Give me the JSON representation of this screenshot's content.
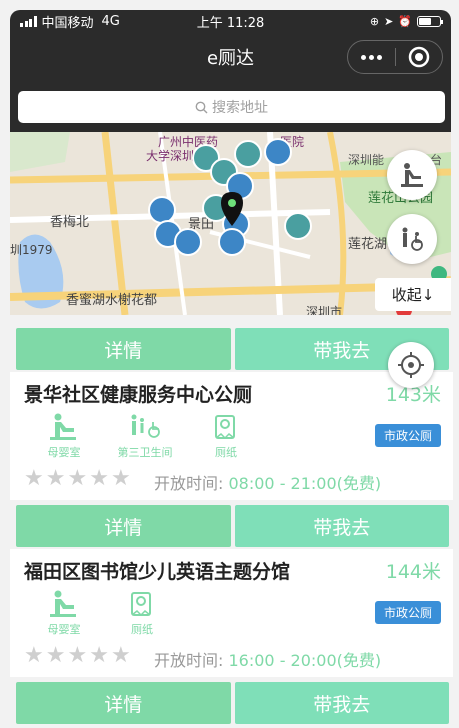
{
  "status_bar": {
    "carrier": "中国移动",
    "network": "4G",
    "time": "上午 11:28"
  },
  "nav": {
    "title": "e厕达",
    "more_icon": "more-dots-icon",
    "close_icon": "target-circle-icon"
  },
  "search": {
    "placeholder": "搜索地址",
    "icon": "search-icon"
  },
  "map": {
    "labels": [
      "广州中医药",
      "大学深圳",
      "医院",
      "深圳能",
      "台",
      "莲花山公园",
      "香梅北",
      "景田",
      "莲花湖",
      "圳1979",
      "香蜜湖水榭花都",
      "深圳市"
    ],
    "collapse_label": "收起↓",
    "fab_icons": [
      "baby-changing-icon",
      "family-accessible-restroom-icon"
    ]
  },
  "buttons": {
    "detail": "详情",
    "navigate": "带我去"
  },
  "colors": {
    "accent": "#7fd9a7",
    "badge": "#3a8fd8",
    "dark_bar": "#2b2b2b"
  },
  "places": [
    {
      "name": "景华社区健康服务中心公厕",
      "distance": "143米",
      "facilities": [
        {
          "label": "母婴室",
          "icon": "baby-changing-icon"
        },
        {
          "label": "第三卫生间",
          "icon": "family-accessible-restroom-icon"
        },
        {
          "label": "厕纸",
          "icon": "toilet-paper-icon"
        }
      ],
      "type": "市政公厕",
      "rating": 0,
      "hours_label": "开放时间:",
      "hours_value": "08:00 - 21:00(免费)"
    },
    {
      "name": "福田区图书馆少儿英语主题分馆",
      "distance": "144米",
      "facilities": [
        {
          "label": "母婴室",
          "icon": "baby-changing-icon"
        },
        {
          "label": "厕纸",
          "icon": "toilet-paper-icon"
        }
      ],
      "type": "市政公厕",
      "rating": 0,
      "hours_label": "开放时间:",
      "hours_value": "16:00 - 20:00(免费)"
    }
  ]
}
